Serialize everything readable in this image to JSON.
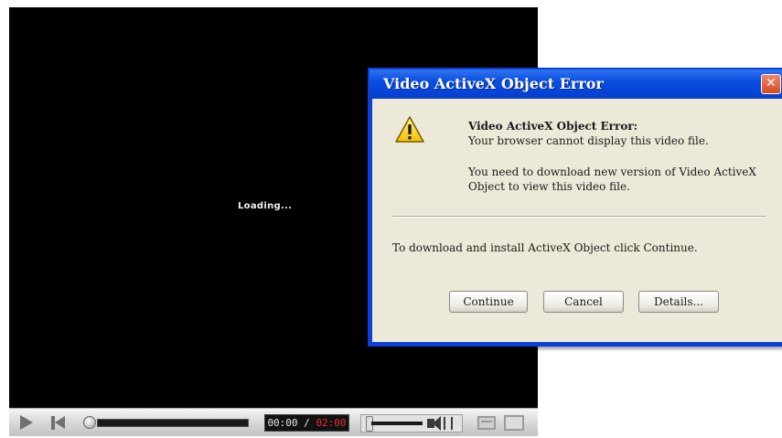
{
  "player": {
    "loading_text": "Loading...",
    "time_current": "00:00",
    "time_separator": " / ",
    "time_total": "02:00",
    "volume_level": 0.55,
    "seek_progress": 0.0
  },
  "dialog": {
    "title": "Video ActiveX Object Error",
    "close_label": "✕",
    "heading": "Video ActiveX Object Error:",
    "line1": "Your browser cannot display this video file.",
    "line2": "You need to download new version of Video ActiveX Object to view this video file.",
    "instruction": "To download and install ActiveX Object click Continue.",
    "buttons": {
      "continue": "Continue",
      "cancel": "Cancel",
      "details": "Details..."
    }
  },
  "colors": {
    "dialog_title_bar": "#0a4ee0",
    "dialog_body": "#ece9d8",
    "close_button": "#d74a22",
    "player_background": "#000000",
    "time_total_color": "#e8322e"
  },
  "icons": {
    "warning": "warning-triangle-icon",
    "play": "play-icon",
    "previous": "skip-back-icon",
    "volume": "speaker-icon",
    "window": "window-mode-icon",
    "fullscreen": "fullscreen-icon"
  }
}
